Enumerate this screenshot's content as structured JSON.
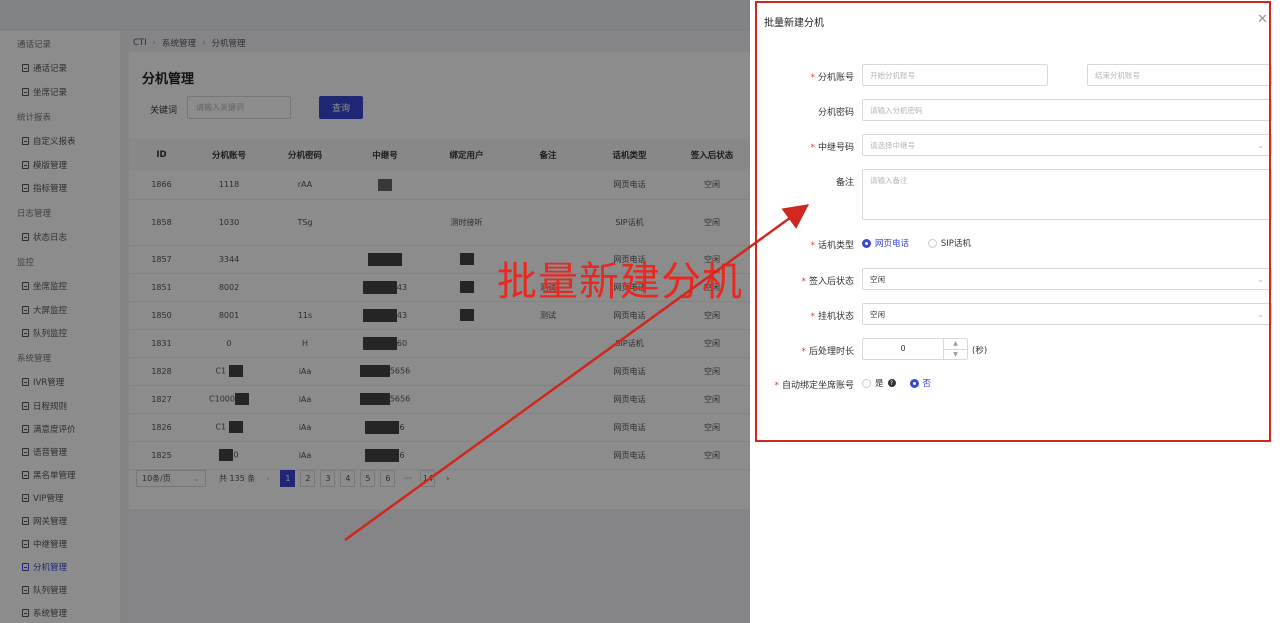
{
  "breadcrumb": [
    "CTI",
    "系统管理",
    "分机管理"
  ],
  "sidebar": {
    "groups": [
      {
        "label": "通话记录",
        "items": [
          "通话记录",
          "坐席记录"
        ]
      },
      {
        "label": "统计报表",
        "items": [
          "自定义报表",
          "模版管理",
          "指标管理"
        ]
      },
      {
        "label": "日志管理",
        "items": [
          "状态日志"
        ]
      },
      {
        "label": "监控",
        "items": [
          "坐席监控",
          "大屏监控",
          "队列监控"
        ]
      },
      {
        "label": "系统管理",
        "items": [
          "IVR管理",
          "日程规则",
          "满意度评价",
          "语音管理",
          "黑名单管理",
          "VIP管理",
          "网关管理",
          "中继管理",
          "分机管理",
          "队列管理",
          "系统管理"
        ]
      }
    ],
    "active": "分机管理"
  },
  "main": {
    "title": "分机管理",
    "keyword_label": "关键词",
    "keyword_placeholder": "请输入关键词",
    "query_button": "查询"
  },
  "table": {
    "columns": [
      "ID",
      "分机账号",
      "分机密码",
      "中继号",
      "绑定用户",
      "备注",
      "话机类型",
      "签入后状态"
    ],
    "rows": [
      {
        "id": "1866",
        "account": "1118",
        "password": "rAA",
        "trunk": "",
        "user": "",
        "note": "",
        "type": "网页电话",
        "status": "空闲"
      },
      {
        "id": "1858",
        "account": "1030",
        "password": "TSg",
        "trunk": "",
        "user": "测时接听",
        "note": "",
        "type": "SIP话机",
        "status": "空闲"
      },
      {
        "id": "1857",
        "account": "3344",
        "password": "",
        "trunk": "",
        "user": "",
        "note": "",
        "type": "网页电话",
        "status": "空闲"
      },
      {
        "id": "1851",
        "account": "8002",
        "password": "",
        "trunk": "43",
        "user": "",
        "note": "测试",
        "type": "网页电话",
        "status": "空闲"
      },
      {
        "id": "1850",
        "account": "8001",
        "password": "11s",
        "trunk": "43",
        "user": "",
        "note": "测试",
        "type": "网页电话",
        "status": "空闲"
      },
      {
        "id": "1831",
        "account": "0",
        "password": "H",
        "trunk": "60",
        "user": "",
        "note": "",
        "type": "SIP话机",
        "status": "空闲"
      },
      {
        "id": "1828",
        "account": "C1",
        "password": "iAa",
        "trunk": "5656",
        "user": "",
        "note": "",
        "type": "网页电话",
        "status": "空闲"
      },
      {
        "id": "1827",
        "account": "C1000",
        "password": "iAa",
        "trunk": "5656",
        "user": "",
        "note": "",
        "type": "网页电话",
        "status": "空闲"
      },
      {
        "id": "1826",
        "account": "C1",
        "password": "iAa",
        "trunk": "6",
        "user": "",
        "note": "",
        "type": "网页电话",
        "status": "空闲"
      },
      {
        "id": "1825",
        "account": "0",
        "password": "iAa",
        "trunk": "6",
        "user": "",
        "note": "",
        "type": "网页电话",
        "status": "空闲"
      }
    ]
  },
  "pagination": {
    "page_size": "10条/页",
    "total": "共 135 条",
    "pages": [
      "1",
      "2",
      "3",
      "4",
      "5",
      "6",
      "···",
      "14"
    ],
    "current": "1"
  },
  "drawer": {
    "title": "批量新建分机",
    "fields": {
      "account_label": "分机账号",
      "account_start_placeholder": "开始分机账号",
      "account_end_placeholder": "结束分机账号",
      "password_label": "分机密码",
      "password_placeholder": "请输入分机密码",
      "trunk_label": "中继号码",
      "trunk_placeholder": "请选择中继号",
      "note_label": "备注",
      "note_placeholder": "请输入备注",
      "phone_type_label": "话机类型",
      "phone_type_options": [
        "网页电话",
        "SIP话机"
      ],
      "phone_type_selected": "网页电话",
      "signin_status_label": "签入后状态",
      "signin_status_value": "空闲",
      "hangup_status_label": "挂机状态",
      "hangup_status_value": "空闲",
      "post_process_label": "后处理时长",
      "post_process_value": "0",
      "post_process_unit": "(秒)",
      "auto_bind_label": "自动绑定坐席账号",
      "auto_bind_options": [
        "是",
        "否"
      ],
      "auto_bind_selected": "否"
    }
  },
  "annotation": {
    "text": "批量新建分机",
    "color": "#e8291f"
  },
  "colors": {
    "primary": "#3a47d5",
    "annotation": "#d0271f"
  }
}
